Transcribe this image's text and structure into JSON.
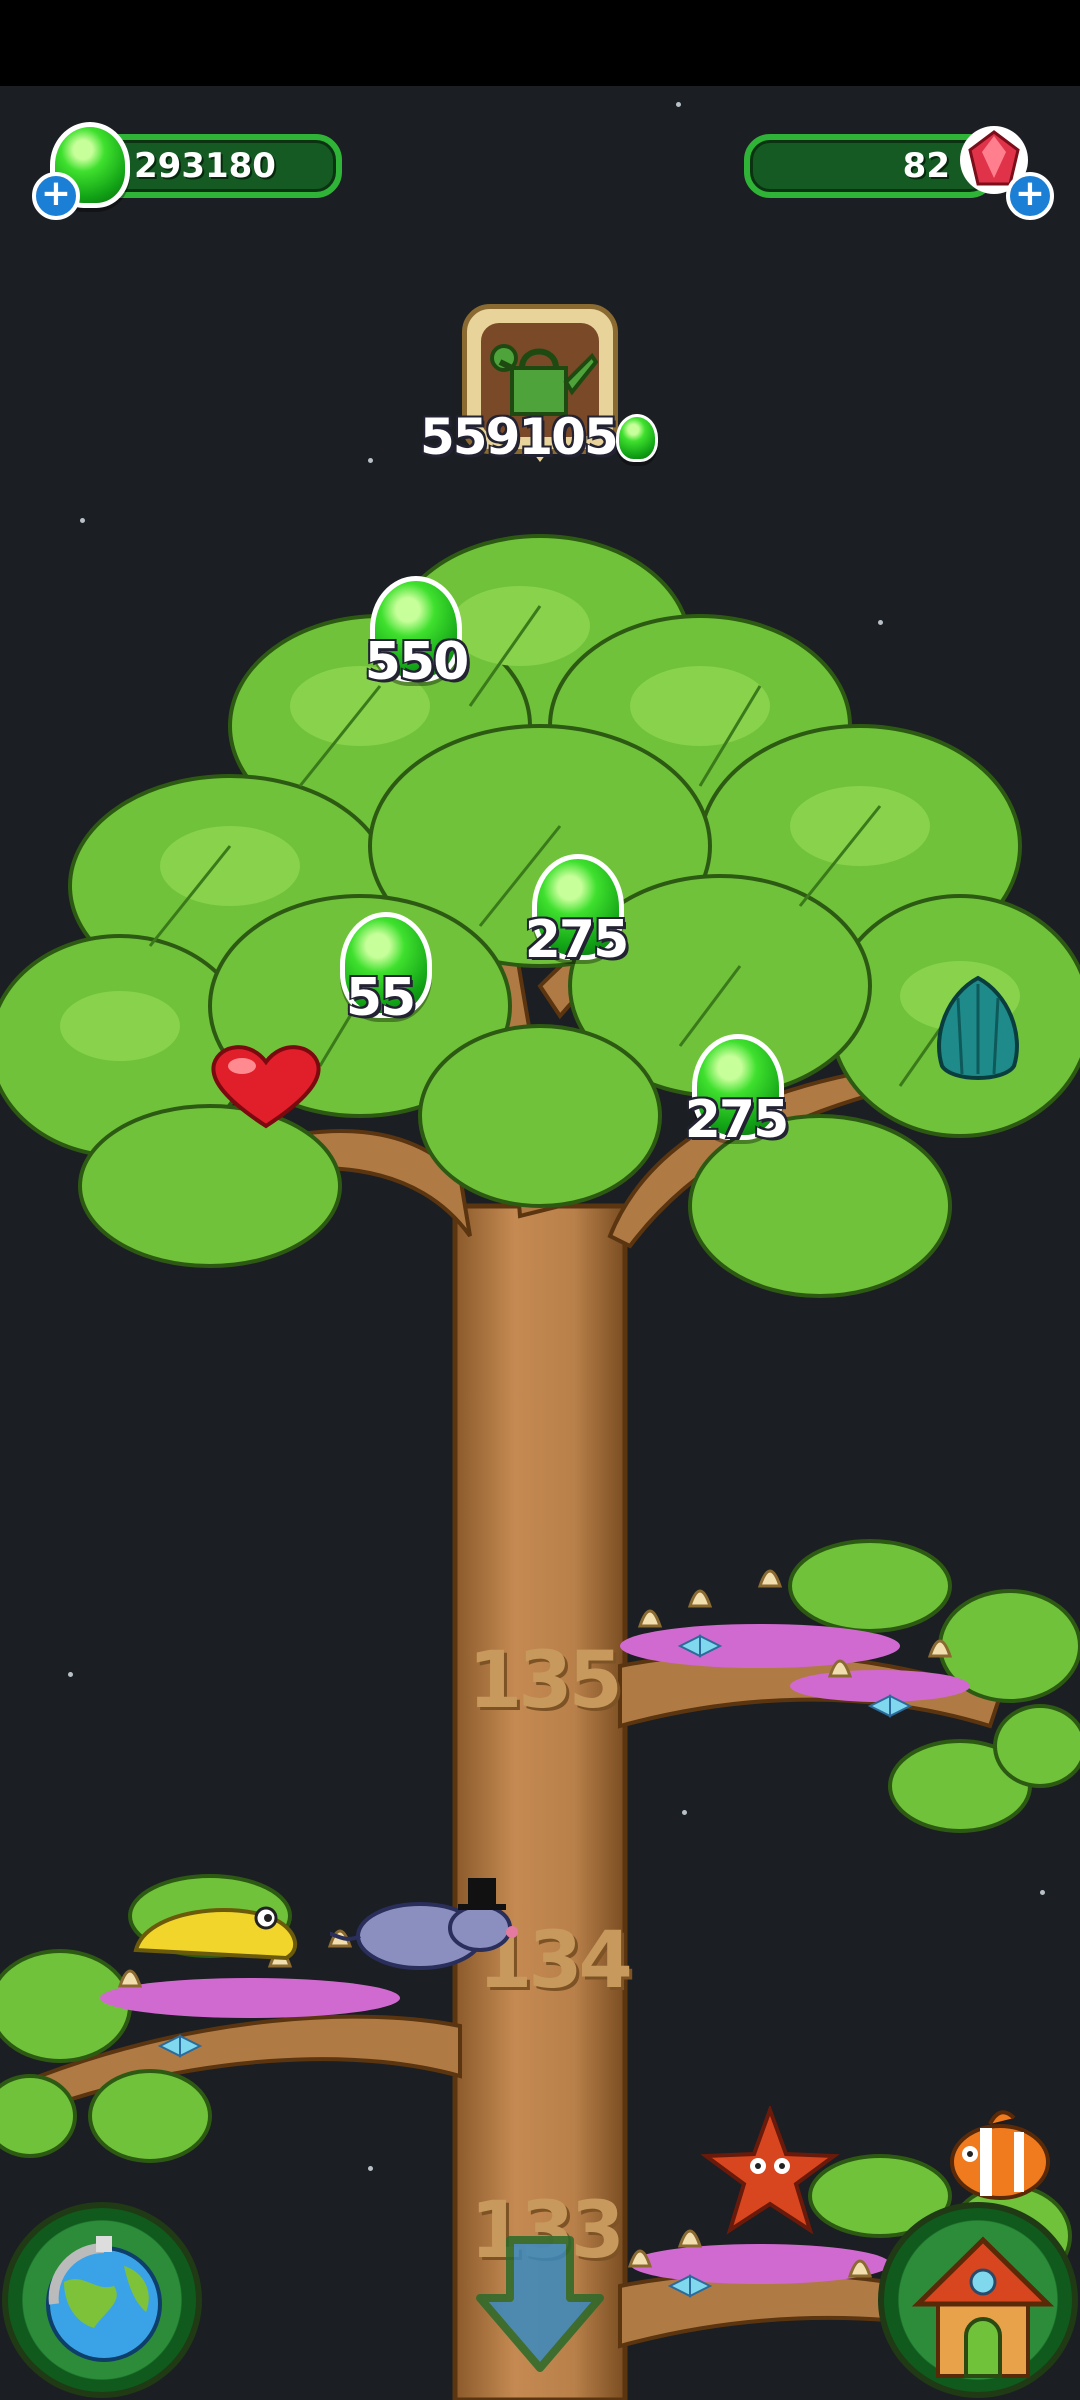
{
  "resources": {
    "green_drops": "293180",
    "ruby_gems": "82"
  },
  "tree_upgrade": {
    "icon": "watering-can-icon",
    "cost": "559105"
  },
  "collectibles": [
    {
      "name": "drop-550",
      "value": "550"
    },
    {
      "name": "drop-55",
      "value": "55"
    },
    {
      "name": "drop-275-a",
      "value": "275"
    },
    {
      "name": "drop-275-b",
      "value": "275"
    }
  ],
  "branches": [
    {
      "level": "135"
    },
    {
      "level": "134"
    },
    {
      "level": "133"
    }
  ],
  "nav": {
    "world_map": "globe-icon",
    "scroll_down": "arrow-down-icon",
    "home": "house-icon"
  },
  "colors": {
    "background": "#1b1e22",
    "leaf": "#6fc23a",
    "trunk": "#b07a45",
    "drop": "#2fd12a",
    "counter_bg": "#155a23"
  }
}
